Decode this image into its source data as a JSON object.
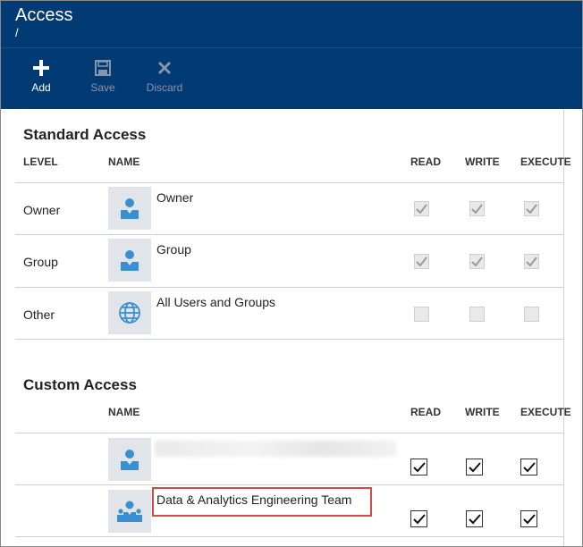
{
  "header": {
    "title": "Access",
    "path": "/",
    "toolbar": [
      {
        "id": "add",
        "label": "Add",
        "icon": "plus-icon"
      },
      {
        "id": "save",
        "label": "Save",
        "icon": "save-icon"
      },
      {
        "id": "discard",
        "label": "Discard",
        "icon": "close-icon"
      }
    ]
  },
  "standard_access": {
    "title": "Standard Access",
    "columns": {
      "level": "LEVEL",
      "name": "NAME",
      "read": "READ",
      "write": "WRITE",
      "execute": "EXECUTE"
    },
    "rows": [
      {
        "level": "Owner",
        "name": "Owner",
        "icon": "user-icon",
        "read": true,
        "write": true,
        "execute": true
      },
      {
        "level": "Group",
        "name": "Group",
        "icon": "user-icon",
        "read": true,
        "write": true,
        "execute": true
      },
      {
        "level": "Other",
        "name": "All Users and Groups",
        "icon": "globe-icon",
        "read": false,
        "write": false,
        "execute": false
      }
    ]
  },
  "custom_access": {
    "title": "Custom Access",
    "columns": {
      "name": "NAME",
      "read": "READ",
      "write": "WRITE",
      "execute": "EXECUTE"
    },
    "rows": [
      {
        "name": "",
        "redacted": true,
        "icon": "user-icon",
        "read": true,
        "write": true,
        "execute": true
      },
      {
        "name": "Data & Analytics Engineering Team",
        "icon": "group-icon",
        "read": true,
        "write": true,
        "execute": true
      }
    ]
  },
  "colors": {
    "header_bg": "#023a73",
    "icon_blue": "#3a8fd0",
    "avatar_bg": "#e1e5ea",
    "highlight": "#d44a45"
  }
}
